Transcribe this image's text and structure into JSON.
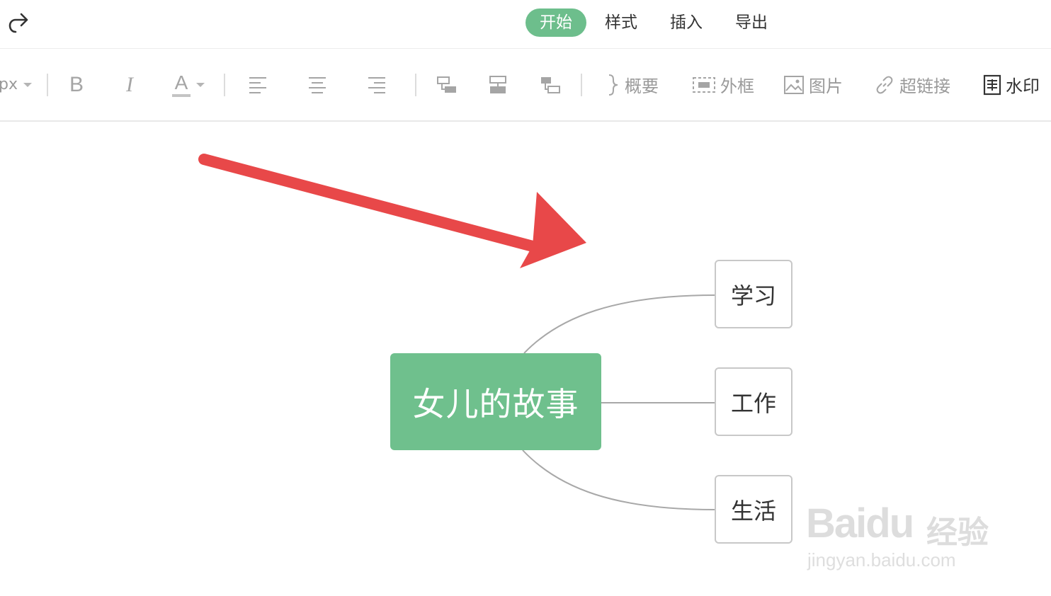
{
  "header": {
    "tabs": [
      {
        "label": "开始",
        "active": true
      },
      {
        "label": "样式",
        "active": false
      },
      {
        "label": "插入",
        "active": false
      },
      {
        "label": "导出",
        "active": false
      }
    ]
  },
  "toolbar": {
    "font_size_value": "px",
    "bold_label": "B",
    "italic_label": "I",
    "font_color_label": "A",
    "summary_label": "概要",
    "border_label": "外框",
    "image_label": "图片",
    "hyperlink_label": "超链接",
    "watermark_label": "水印"
  },
  "mindmap": {
    "root": "女儿的故事",
    "children": [
      "学习",
      "工作",
      "生活"
    ]
  },
  "watermark": {
    "brand": "Bai",
    "brand_du": "du",
    "brand_cn": "经验",
    "url": "jingyan.baidu.com"
  },
  "colors": {
    "accent": "#6dbe8c",
    "root_fill": "#6fc08d",
    "arrow": "#e84849"
  },
  "icons": {
    "redo": "redo-icon",
    "align_left": "align-left-icon",
    "align_center": "align-center-icon",
    "align_right": "align-right-icon",
    "insert_child": "insert-child-icon",
    "insert_sibling": "insert-sibling-icon",
    "insert_parent": "insert-parent-icon",
    "summary": "brace-icon",
    "border": "dashed-box-icon",
    "image": "image-icon",
    "link": "link-icon",
    "watermark": "watermark-icon"
  }
}
